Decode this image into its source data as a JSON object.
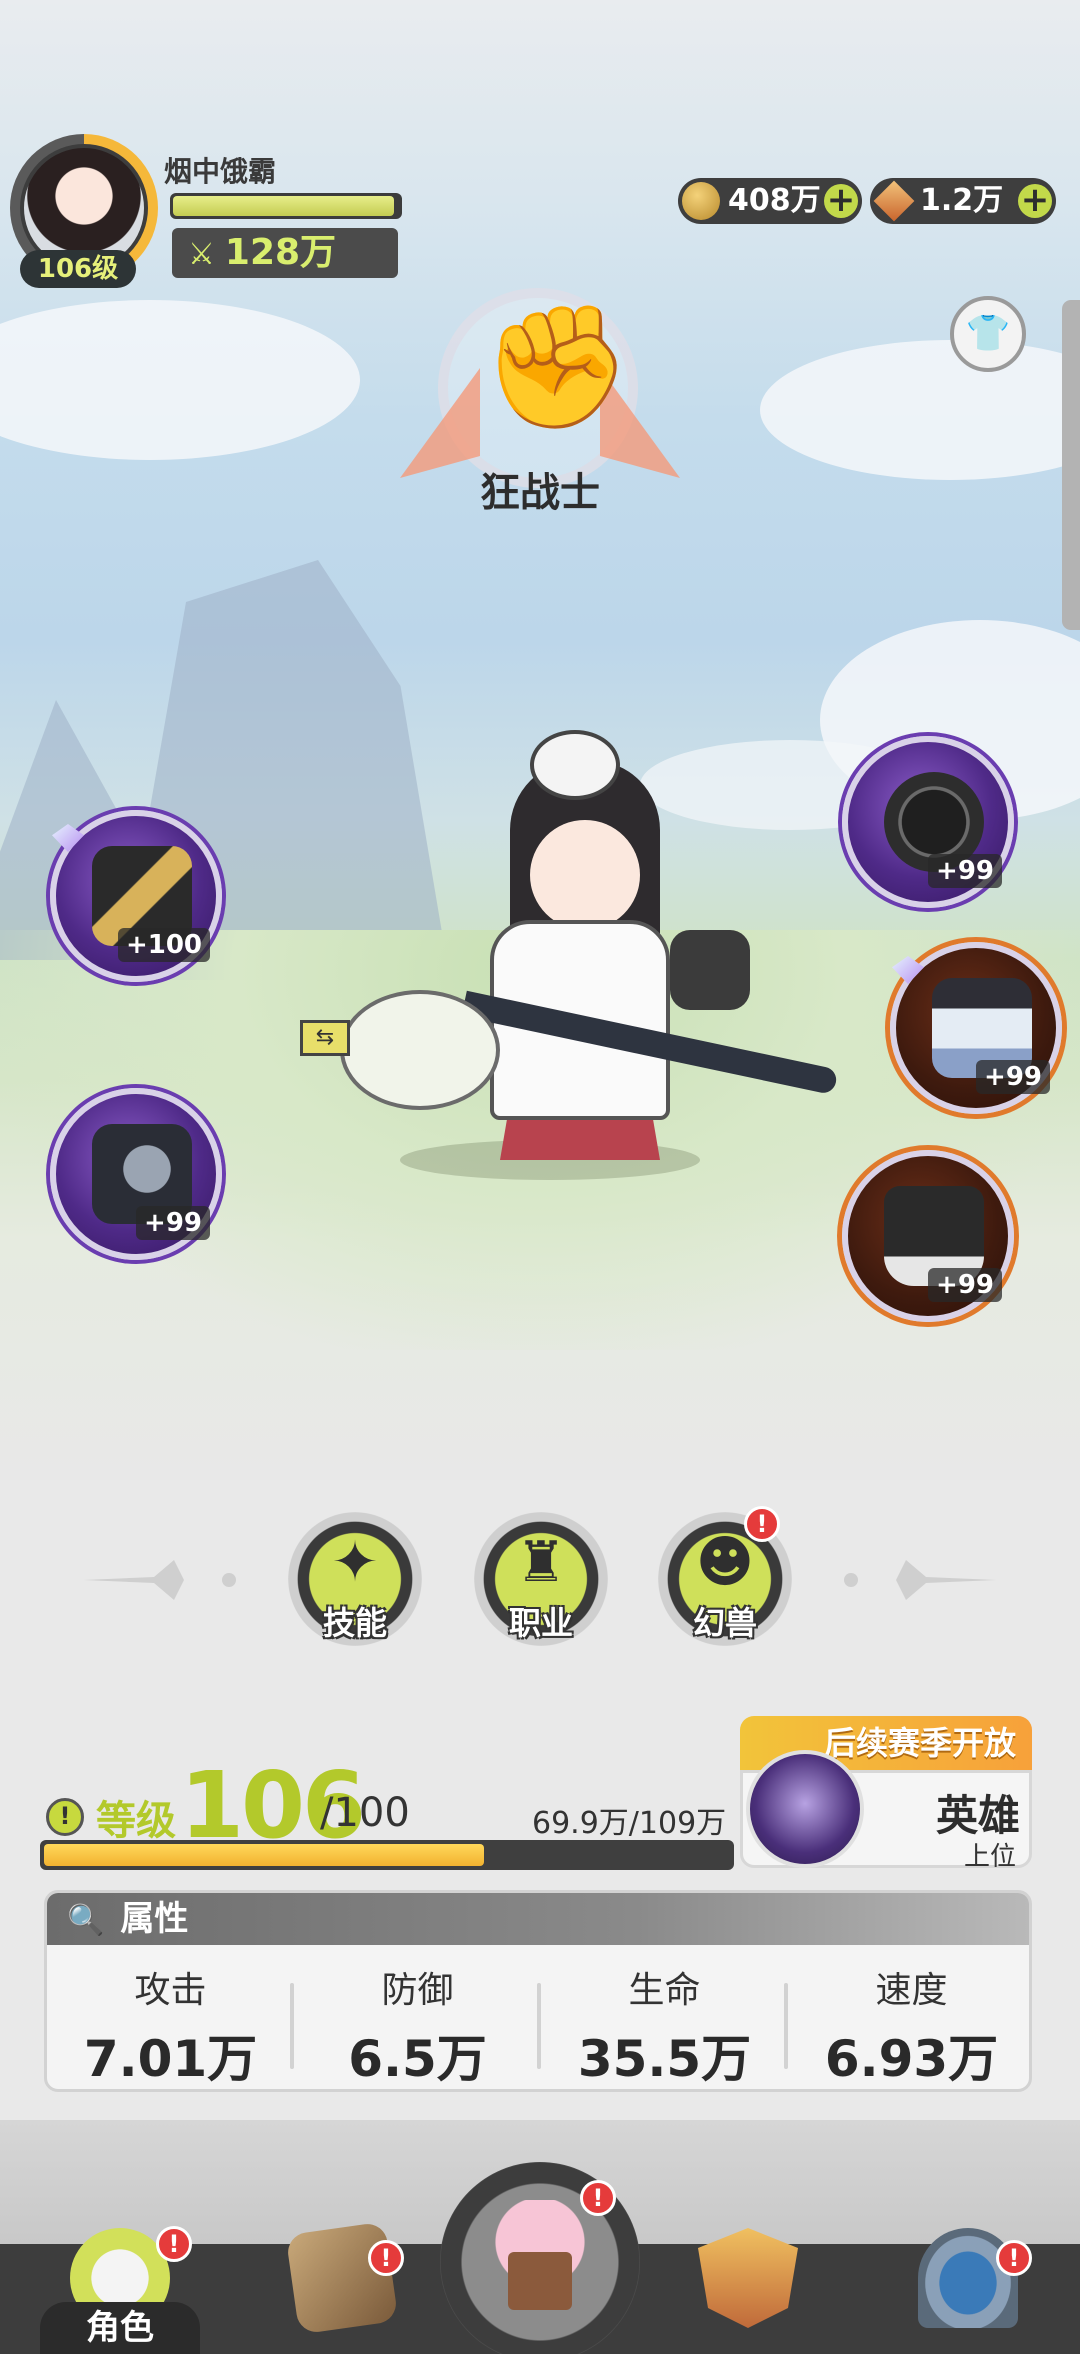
{
  "player": {
    "name": "烟中饿霸",
    "level_badge": "106级",
    "combat_power": "128万",
    "hp_fraction": 0.98
  },
  "currencies": [
    {
      "icon": "gold-coin-icon",
      "amount": "408万"
    },
    {
      "icon": "crystal-icon",
      "amount": "1.2万"
    }
  ],
  "class_emblem": {
    "name": "狂战士",
    "icon": "fist-emblem-icon"
  },
  "equipment": {
    "left": [
      {
        "slot": "weapon",
        "icon": "katana-icon",
        "level": "+100",
        "rarity": "purple",
        "gem": true
      },
      {
        "slot": "gauntlet",
        "icon": "gauntlet-icon",
        "level": "+99",
        "rarity": "purple",
        "gem": false
      }
    ],
    "right": [
      {
        "slot": "hat",
        "icon": "straw-hat-icon",
        "level": "+99",
        "rarity": "purple",
        "gem": false
      },
      {
        "slot": "armor",
        "icon": "robe-armor-icon",
        "level": "+99",
        "rarity": "orange",
        "gem": true
      },
      {
        "slot": "boots",
        "icon": "boots-icon",
        "level": "+99",
        "rarity": "orange",
        "gem": false
      }
    ]
  },
  "menu_buttons": [
    {
      "label": "技能",
      "icon": "skill-icon",
      "alert": false
    },
    {
      "label": "职业",
      "icon": "class-icon",
      "alert": false
    },
    {
      "label": "幻兽",
      "icon": "beast-icon",
      "alert": true
    }
  ],
  "level": {
    "label": "等级",
    "current": "106",
    "max": "/100",
    "exp_text": "69.9万/109万",
    "exp_fraction": 0.641
  },
  "season_card": {
    "tag": "后续赛季开放",
    "title": "英雄",
    "subtitle": "上位"
  },
  "attributes": {
    "title": "属性",
    "items": [
      {
        "name": "攻击",
        "value": "7.01万"
      },
      {
        "name": "防御",
        "value": "6.5万"
      },
      {
        "name": "生命",
        "value": "35.5万"
      },
      {
        "name": "速度",
        "value": "6.93万"
      }
    ]
  },
  "nav": {
    "active_label": "角色",
    "items": [
      {
        "icon": "character-icon",
        "alert": true
      },
      {
        "icon": "book-icon",
        "alert": true
      },
      {
        "icon": "home-icon",
        "alert": true
      },
      {
        "icon": "guild-shield-icon",
        "alert": false
      },
      {
        "icon": "portal-icon",
        "alert": true
      }
    ]
  },
  "alert_mark": "!",
  "colors": {
    "accent_green": "#c7d93e",
    "alert_red": "#e53b3b",
    "rarity_purple": "#6a3db0",
    "rarity_orange": "#e07a2c"
  }
}
